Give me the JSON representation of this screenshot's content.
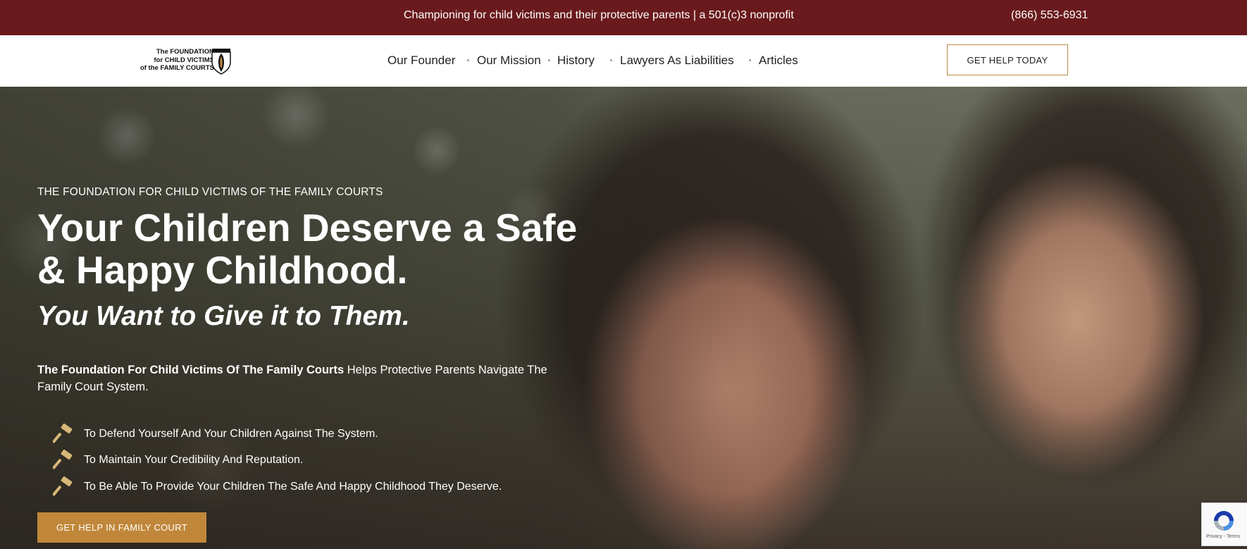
{
  "topbar": {
    "tagline": "Championing for child victims and their protective parents | a 501(c)3 nonprofit",
    "phone": "(866) 553-6931",
    "background": "#6a1a1c"
  },
  "logo": {
    "line1": "The FOUNDATION",
    "line2": "for CHILD VICTIMS",
    "line3": "of the FAMILY COURTS"
  },
  "nav": {
    "items": [
      {
        "label": "Our Founder"
      },
      {
        "label": "Our Mission"
      },
      {
        "label": "History"
      },
      {
        "label": "Lawyers As Liabilities"
      },
      {
        "label": "Articles"
      }
    ],
    "cta_label": "GET HELP TODAY"
  },
  "hero": {
    "eyebrow": "THE FOUNDATION FOR CHILD VICTIMS OF THE FAMILY COURTS",
    "headline": "Your Children Deserve a Safe & Happy Childhood.",
    "subhead": "You Want to Give it to Them.",
    "intro_bold": "The Foundation For Child Victims Of The Family Courts",
    "intro_rest": " Helps Protective Parents Navigate The Family Court System.",
    "bullets": [
      {
        "icon": "gavel-icon",
        "text": "To Defend Yourself And Your Children Against The System."
      },
      {
        "icon": "gavel-icon",
        "text": "To Maintain Your Credibility And Reputation."
      },
      {
        "icon": "gavel-icon",
        "text": "To Be Able To Provide Your Children The Safe And Happy Childhood They Deserve."
      }
    ],
    "cta_label": "GET HELP IN FAMILY COURT",
    "accent": "#c0873a"
  },
  "recaptcha": {
    "text": "Privacy - Terms"
  }
}
